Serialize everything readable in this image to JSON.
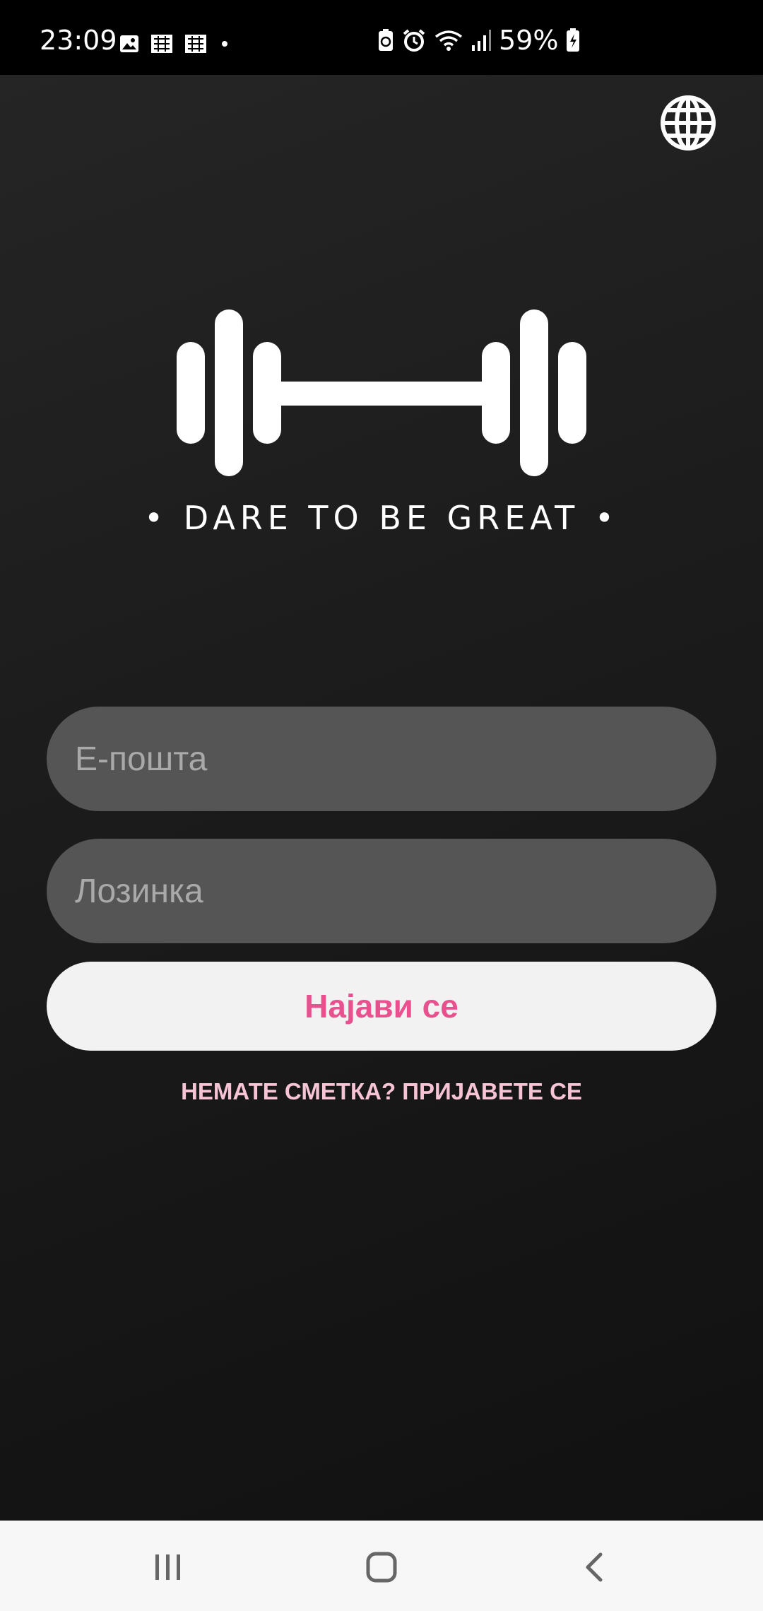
{
  "status_bar": {
    "time": "23:09",
    "battery": "59%",
    "icons": [
      "gallery-icon",
      "notification-icon",
      "notification-icon",
      "dot-icon",
      "battery-saver-icon",
      "alarm-icon",
      "wifi-icon",
      "signal-icon",
      "battery-icon"
    ]
  },
  "header": {
    "language_icon": "globe-icon"
  },
  "logo": {
    "icon": "dumbbell-icon",
    "tagline": "• DARE TO BE GREAT •"
  },
  "form": {
    "email_placeholder": "Е-пошта",
    "password_placeholder": "Лозинка",
    "login_label": "Најави се",
    "register_link": "НЕМАТЕ СМЕТКА? ПРИЈАВЕТЕ СЕ"
  },
  "colors": {
    "accent": "#e8508e",
    "link": "#f7c4d6",
    "field_bg": "#555555",
    "button_bg": "#f2f2f2"
  },
  "nav_bar": {
    "recents_icon": "recents-icon",
    "home_icon": "home-icon",
    "back_icon": "back-icon"
  }
}
